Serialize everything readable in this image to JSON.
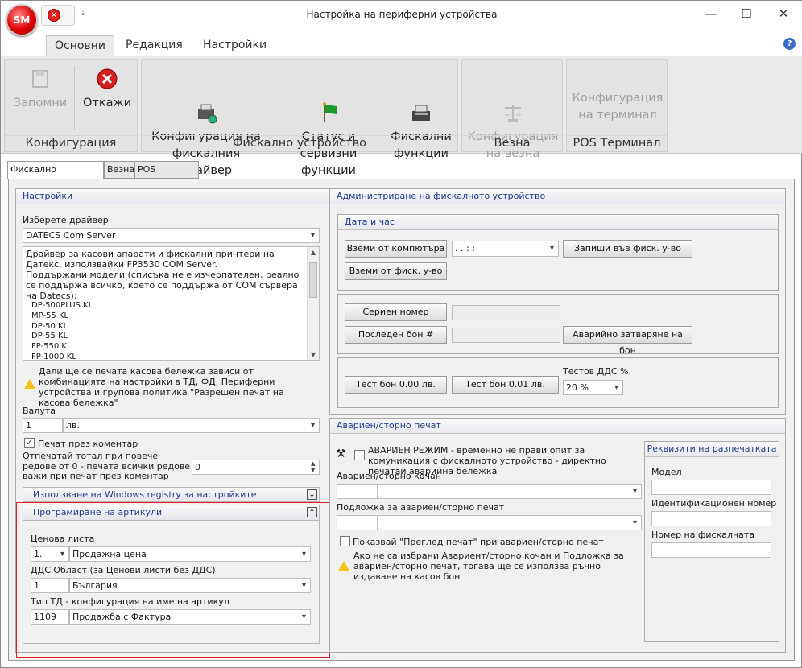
{
  "window": {
    "title": "Настройка на периферни устройства",
    "logo_text": "SM",
    "qat_arrow": "⇣",
    "minimize": "—",
    "maximize": "☐",
    "close": "✕"
  },
  "ribbon": {
    "tabs": [
      {
        "label": "Основни"
      },
      {
        "label": "Редакция"
      },
      {
        "label": "Настройки"
      }
    ],
    "help": "?",
    "groups": {
      "config": {
        "label": "Конфигурация",
        "save": "Запомни",
        "cancel": "Откажи"
      },
      "fiscal": {
        "label": "Фискално устройство",
        "driver": "Конфигурация на\nфискалния драйвер",
        "status": "Статус и сервизни\nфункции",
        "functions": "Фискални\nфункции"
      },
      "scale": {
        "label": "Везна",
        "config": "Конфигурация\nна везна"
      },
      "pos": {
        "label": "POS Терминал",
        "config": "Конфигурация\nна терминал"
      }
    }
  },
  "subtabs": [
    {
      "label": "Фискално устройство"
    },
    {
      "label": "Везна"
    },
    {
      "label": "POS терминал"
    }
  ],
  "settings": {
    "title": "Настройки",
    "driver_label": "Изберете драйвер",
    "driver_value": "DATECS Com Server",
    "description": "Драйвер за касови апарати и фискални принтери на Датекс, използвайки FP3530 COM Server.\nПоддържани модели (списъка не е изчерпателен, реално се поддържа всичко, което се поддържа от COM сървера на Datecs):",
    "models": [
      "DP-500PLUS KL",
      "MP-55 KL",
      "DP-50 KL",
      "DP-55 KL",
      "FP-550 KL",
      "FP-1000 KL"
    ],
    "warning": "Дали ще се печата касова бележка зависи от комбинацията на настройки в ТД, ФД, Периферни устройства и групова политика \"Разрешен печат на касова бележка\"",
    "currency_label": "Валута",
    "currency_code": "1",
    "currency_name": "лв.",
    "print_comment": "Печат през коментар",
    "print_comment_checked": "✓",
    "total_label": "Отпечатай тотал при повече редове от 0 - печата всички редове важи при печат през коментар",
    "total_value": "0",
    "registry": "Използване на Windows registry за настройките",
    "registry_toggle": "⌄",
    "articles": {
      "title": "Програмиране на артикули",
      "toggle": "⌃",
      "price_label": "Ценова листа",
      "price_code": "1.",
      "price_name": "Продажна цена",
      "vat_label": "ДДС Област (за Ценови листи без ДДС)",
      "vat_code": "1",
      "vat_name": "България",
      "td_label": "Тип ТД - конфигурация на име на артикул",
      "td_code": "1109",
      "td_name": "Продажба с Фактура"
    }
  },
  "admin": {
    "title": "Администриране на фискалното устройство",
    "datetime": {
      "title": "Дата и час",
      "from_pc": "Вземи от компютъра",
      "value": " .  .       :  :",
      "write": "Запиши във фиск. у-во",
      "from_device": "Вземи от фиск. у-во"
    },
    "serial": "Сериен номер",
    "last_receipt": "Последен бон #",
    "emergency_close": "Аварийно затваряне на бон",
    "test_0": "Тест бон 0.00 лв.",
    "test_1": "Тест бон 0.01 лв.",
    "test_vat_label": "Тестов ДДС %",
    "test_vat_value": "20 %"
  },
  "emergency": {
    "title": "Авариен/сторно печат",
    "mode": "АВАРИЕН РЕЖИМ - временно не прави опит за комуникация с фискалното устройство - директно печатай аварийна бележка",
    "register_label": "Авариен/сторно кочан",
    "pad_label": "Подложка за авариен/сторно печат",
    "preview": "Показвай \"Преглед печат\" при авариен/сторно печат",
    "note": "Ако не са избрани Авариент/сторно кочан и Подложка за авариен/сторно печат, тогава  ще се използва ръчно издаване на касов бон",
    "requisites": {
      "title": "Реквизити на разпечатката",
      "model": "Модел",
      "id": "Идентификационен номер",
      "memory": "Номер на фискалната памет"
    }
  }
}
